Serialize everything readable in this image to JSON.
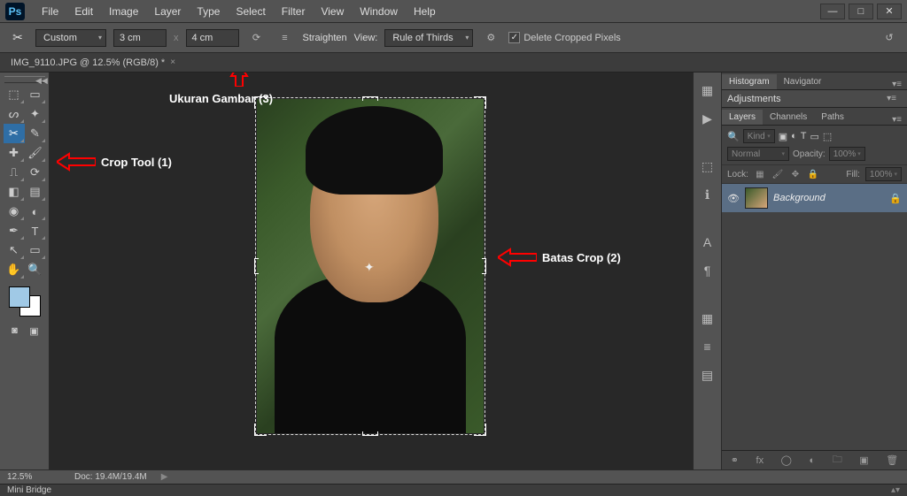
{
  "app": {
    "logo": "Ps"
  },
  "menu": [
    "File",
    "Edit",
    "Image",
    "Layer",
    "Type",
    "Select",
    "Filter",
    "View",
    "Window",
    "Help"
  ],
  "window_controls": {
    "min": "—",
    "max": "□",
    "close": "✕"
  },
  "options": {
    "preset": "Custom",
    "width": "3 cm",
    "sep": "x",
    "height": "4 cm",
    "straighten": "Straighten",
    "view_label": "View:",
    "view_value": "Rule of Thirds",
    "delete_cropped": "Delete Cropped Pixels",
    "delete_checked": "✓"
  },
  "doc_tab": {
    "title": "IMG_9110.JPG @ 12.5% (RGB/8) *",
    "close": "×"
  },
  "annotations": {
    "crop_tool": "Crop Tool  (1)",
    "batas_crop": "Batas Crop  (2)",
    "ukuran_gambar": "Ukuran Gambar  (3)"
  },
  "right_tabs": {
    "histogram": "Histogram",
    "navigator": "Navigator",
    "adjustments": "Adjustments",
    "layers": "Layers",
    "channels": "Channels",
    "paths": "Paths"
  },
  "layers_panel": {
    "filter": "Kind",
    "blend": "Normal",
    "opacity_label": "Opacity:",
    "opacity_value": "100%",
    "lock_label": "Lock:",
    "fill_label": "Fill:",
    "fill_value": "100%",
    "background": "Background"
  },
  "status": {
    "zoom": "12.5%",
    "doc": "Doc: 19.4M/19.4M"
  },
  "mini_bridge": "Mini Bridge",
  "collapse_glyph": "◀◀"
}
